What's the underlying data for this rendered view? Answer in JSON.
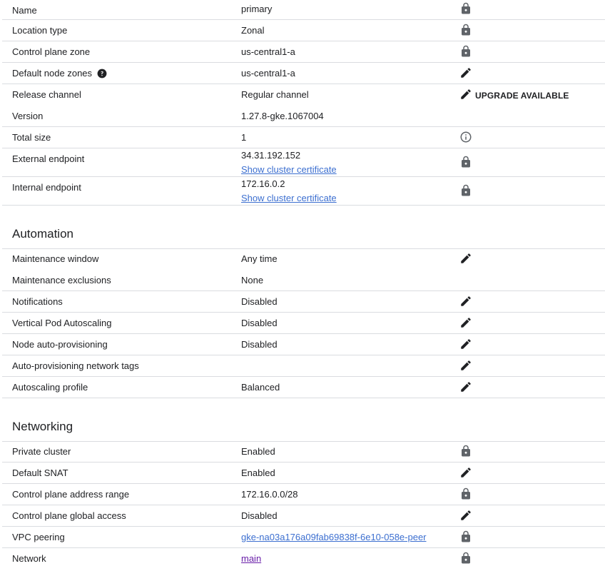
{
  "colors": {
    "link": "#3c6fd0",
    "visited_link": "#681da8",
    "divider": "#dadce0",
    "icon_gray": "#5f6368",
    "icon_dark": "#202124"
  },
  "details": {
    "rows": [
      {
        "label": "Name",
        "value": "primary",
        "icon": "lock-icon"
      },
      {
        "label": "Location type",
        "value": "Zonal",
        "icon": "lock-icon"
      },
      {
        "label": "Control plane zone",
        "value": "us-central1-a",
        "icon": "lock-icon"
      },
      {
        "label": "Default node zones",
        "value": "us-central1-a",
        "icon": "edit-icon",
        "help_icon": "help-icon"
      },
      {
        "label": "Release channel",
        "value": "Regular channel",
        "icon": "edit-icon",
        "action_text": "UPGRADE AVAILABLE"
      },
      {
        "label": "Version",
        "value": "1.27.8-gke.1067004"
      },
      {
        "label": "Total size",
        "value": "1",
        "icon": "info-icon"
      },
      {
        "label": "External endpoint",
        "value": "34.31.192.152",
        "link": "Show cluster certificate",
        "icon": "lock-icon"
      },
      {
        "label": "Internal endpoint",
        "value": "172.16.0.2",
        "link": "Show cluster certificate",
        "icon": "lock-icon"
      }
    ]
  },
  "automation": {
    "title": "Automation",
    "rows": [
      {
        "label": "Maintenance window",
        "value": "Any time",
        "icon": "edit-icon"
      },
      {
        "label": "Maintenance exclusions",
        "value": "None"
      },
      {
        "label": "Notifications",
        "value": "Disabled",
        "icon": "edit-icon"
      },
      {
        "label": "Vertical Pod Autoscaling",
        "value": "Disabled",
        "icon": "edit-icon"
      },
      {
        "label": "Node auto-provisioning",
        "value": "Disabled",
        "icon": "edit-icon"
      },
      {
        "label": "Auto-provisioning network tags",
        "value": "",
        "icon": "edit-icon"
      },
      {
        "label": "Autoscaling profile",
        "value": "Balanced",
        "icon": "edit-icon"
      }
    ]
  },
  "networking": {
    "title": "Networking",
    "rows": [
      {
        "label": "Private cluster",
        "value": "Enabled",
        "icon": "lock-icon"
      },
      {
        "label": "Default SNAT",
        "value": "Enabled",
        "icon": "edit-icon"
      },
      {
        "label": "Control plane address range",
        "value": "172.16.0.0/28",
        "icon": "lock-icon"
      },
      {
        "label": "Control plane global access",
        "value": "Disabled",
        "icon": "edit-icon"
      },
      {
        "label": "VPC peering",
        "value": "gke-na03a176a09fab69838f-6e10-058e-peer",
        "icon": "lock-icon"
      },
      {
        "label": "Network",
        "value": "main",
        "icon": "lock-icon"
      }
    ]
  }
}
